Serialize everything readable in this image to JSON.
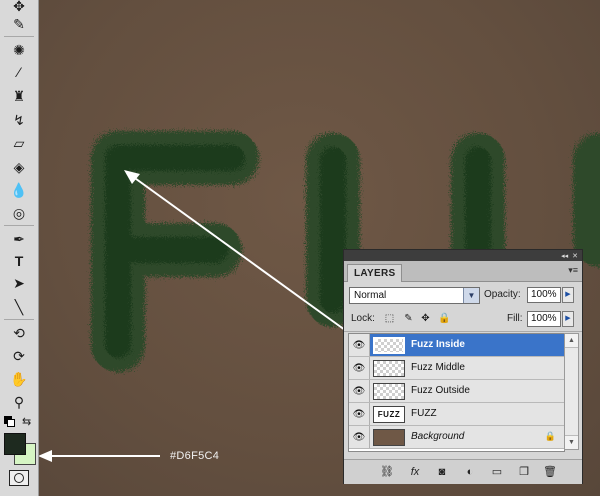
{
  "annotation": {
    "color_label": "#D6F5C4"
  },
  "toolbar": {
    "foreground_color": "#1E2A1F",
    "background_color": "#D6F5C4",
    "tools": [
      "move-icon",
      "eyedropper-icon",
      "spot-healing-icon",
      "brush-icon",
      "clone-stamp-icon",
      "history-brush-icon",
      "eraser-icon",
      "paint-bucket-icon",
      "blur-icon",
      "dodge-icon",
      "pen-icon",
      "type-icon",
      "path-selection-icon",
      "line-icon",
      "3d-rotate-icon",
      "3d-orbit-icon",
      "hand-icon",
      "zoom-icon"
    ]
  },
  "panel": {
    "tab": "LAYERS",
    "blend_mode": "Normal",
    "opacity_label": "Opacity:",
    "opacity": "100%",
    "lock_label": "Lock:",
    "fill_label": "Fill:",
    "fill": "100%",
    "layers": [
      {
        "name": "Fuzz Inside",
        "selected": true,
        "thumb": "transparent"
      },
      {
        "name": "Fuzz Middle",
        "selected": false,
        "thumb": "transparent"
      },
      {
        "name": "Fuzz Outside",
        "selected": false,
        "thumb": "transparent"
      },
      {
        "name": "FUZZ",
        "selected": false,
        "thumb": "text",
        "thumb_text": "FUZZ"
      },
      {
        "name": "Background",
        "selected": false,
        "thumb": "brown",
        "italic": true,
        "locked": true
      }
    ]
  }
}
